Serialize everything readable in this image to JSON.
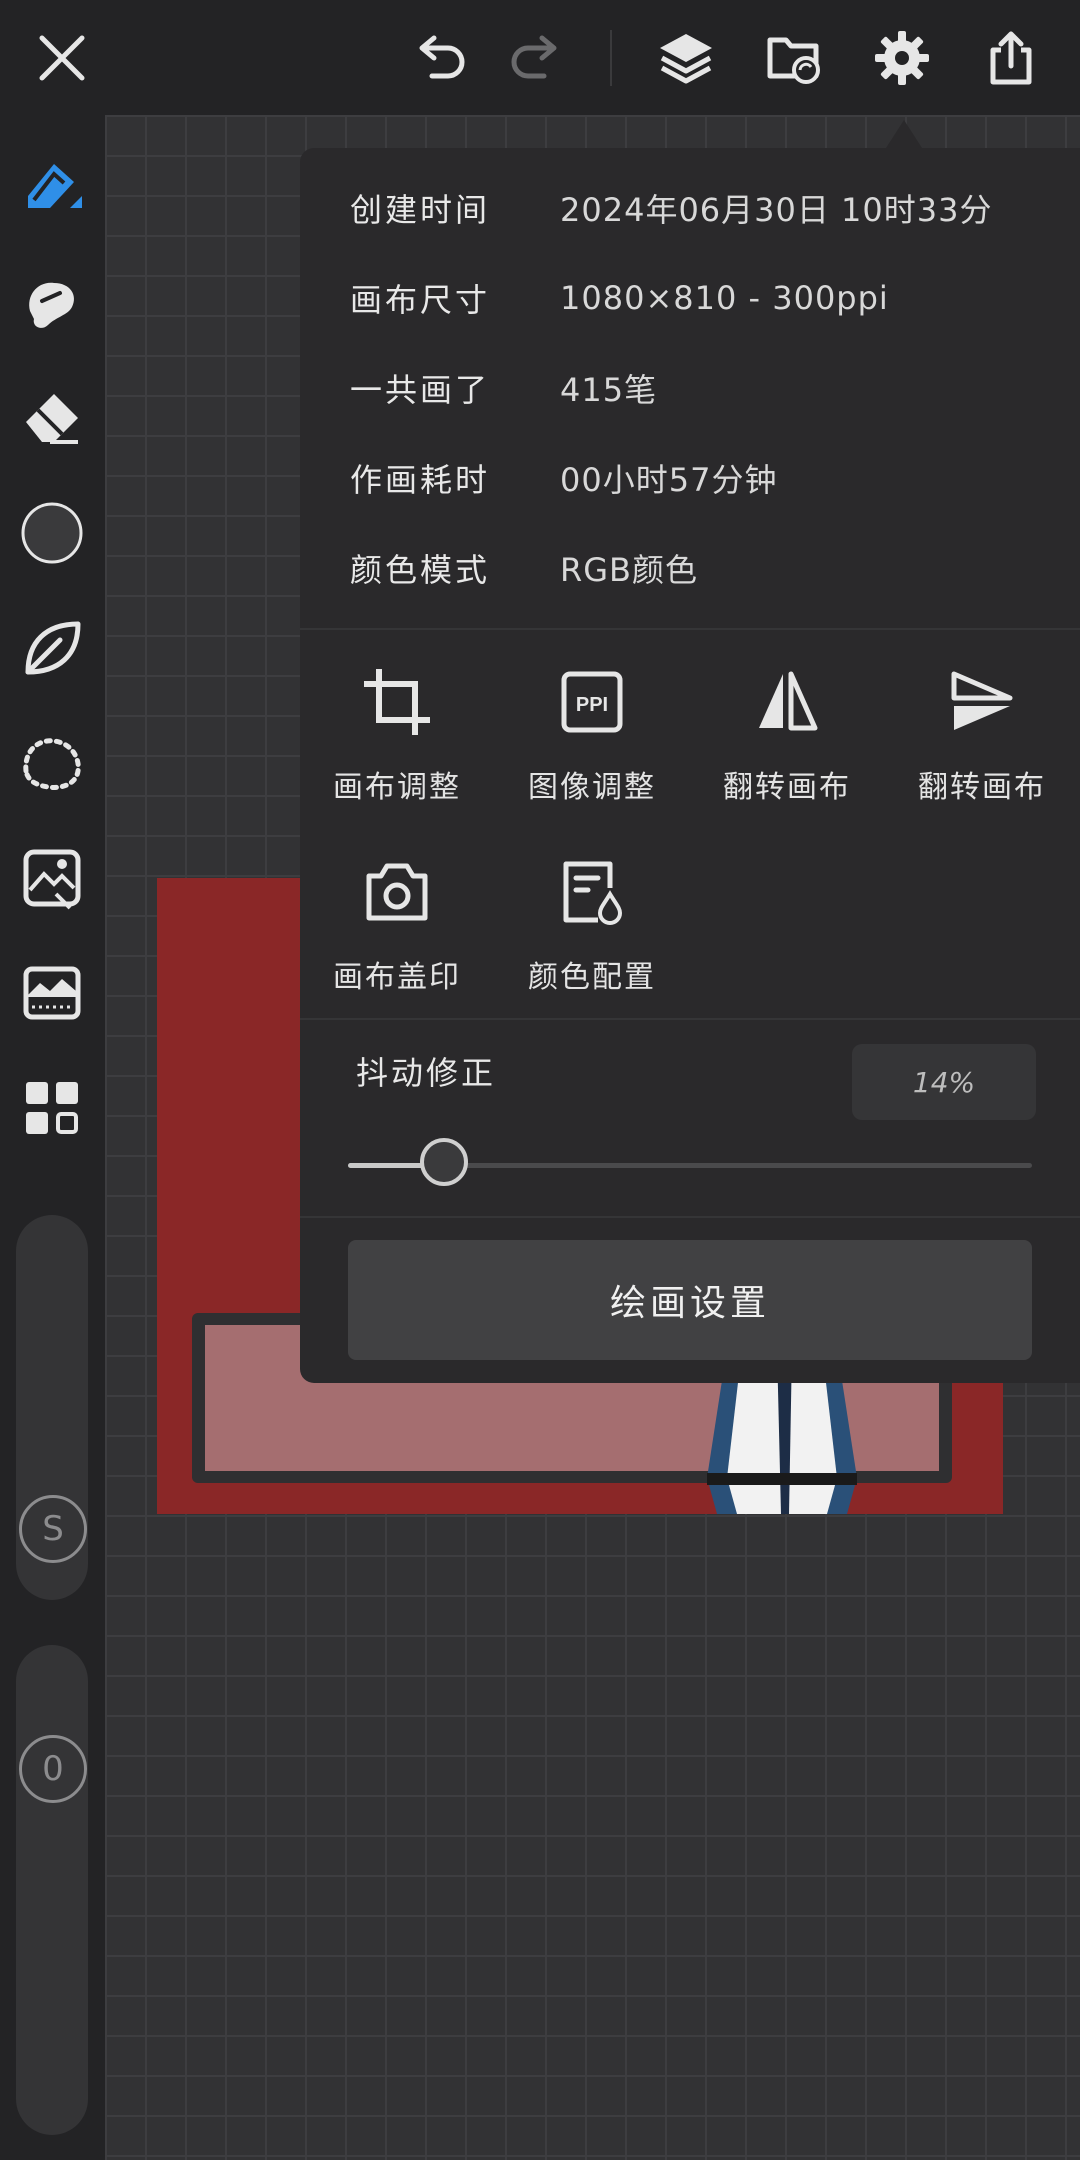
{
  "toolbar": {
    "icons": [
      "close-icon",
      "undo-icon",
      "redo-icon",
      "layers-icon",
      "folder-sync-icon",
      "gear-icon",
      "share-icon"
    ]
  },
  "sidebar": {
    "tools": [
      "pen-icon",
      "smudge-icon",
      "eraser-icon",
      "color-swatch",
      "leaf-icon",
      "lasso-icon",
      "image-import-icon",
      "adjust-image-icon",
      "grid-icon"
    ],
    "size_marker": "S",
    "opacity_marker": "0"
  },
  "panel": {
    "info": [
      {
        "label": "创建时间",
        "value": "2024年06月30日 10时33分"
      },
      {
        "label": "画布尺寸",
        "value": "1080×810 - 300ppi"
      },
      {
        "label": "一共画了",
        "value": "415笔"
      },
      {
        "label": "作画耗时",
        "value": "00小时57分钟"
      },
      {
        "label": "颜色模式",
        "value": "RGB颜色"
      }
    ],
    "actions": [
      {
        "label": "画布调整",
        "icon": "crop-icon"
      },
      {
        "label": "图像调整",
        "icon": "ppi-icon",
        "icon_text": "PPI"
      },
      {
        "label": "翻转画布",
        "icon": "flip-horizontal-icon"
      },
      {
        "label": "翻转画布",
        "icon": "flip-vertical-icon"
      },
      {
        "label": "画布盖印",
        "icon": "camera-icon"
      },
      {
        "label": "颜色配置",
        "icon": "color-profile-icon"
      }
    ],
    "stabilizer": {
      "label": "抖动修正",
      "value_text": "14%",
      "value": 0.14
    },
    "paint_settings_label": "绘画设置"
  },
  "colors": {
    "accent": "#2f8fe8",
    "panel": "#2a292b",
    "artwork": "#8a2727"
  }
}
